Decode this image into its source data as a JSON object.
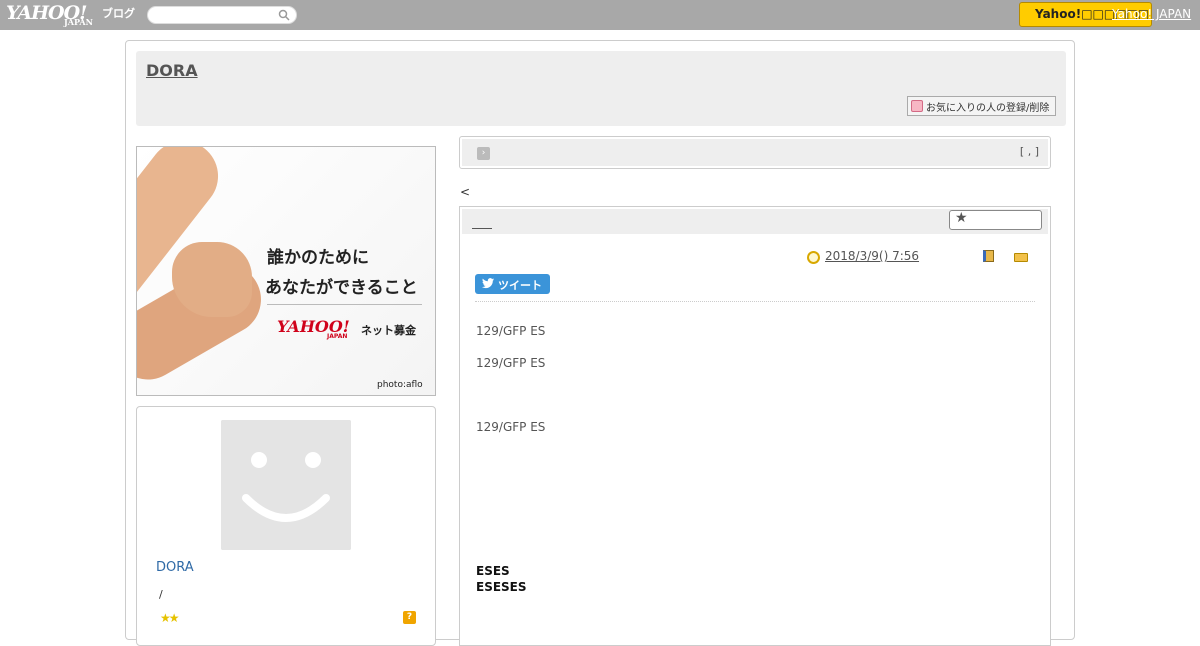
{
  "topbar": {
    "logo_main": "YAHOO!",
    "logo_sub": "JAPAN",
    "logo_service": "ブログ",
    "search_placeholder": "",
    "promo_label": "Yahoo!□□□□□□",
    "yj_link": "Yahoo! JAPAN"
  },
  "header": {
    "blog_title": "DORA",
    "fav_button": "お気に入りの人の登録/削除"
  },
  "banner": {
    "line1": "誰かのために",
    "line2": "あなたができること",
    "brand": "YAHOO!",
    "brand_sub": "JAPAN",
    "brand_service": "ネット募金",
    "credit": "photo:aflo"
  },
  "profile": {
    "name": "DORA",
    "sub": "/",
    "stars": "★★",
    "help": "?"
  },
  "nav": {
    "arrow": "›",
    "bracket": "[ , ]"
  },
  "back_link": "<",
  "article": {
    "date": "2018/3/9()  7:56",
    "tweet_label": "ツイート",
    "paragraphs": [
      "129/GFP ES",
      "129/GFP ES",
      "129/GFP ES"
    ],
    "bold_lines": [
      "ESES",
      "ESESES"
    ]
  },
  "colors": {
    "topbar": "#a8a8a8",
    "promo": "#ffcc00",
    "tweet": "#3b94d9",
    "link": "#2f6aa6"
  }
}
